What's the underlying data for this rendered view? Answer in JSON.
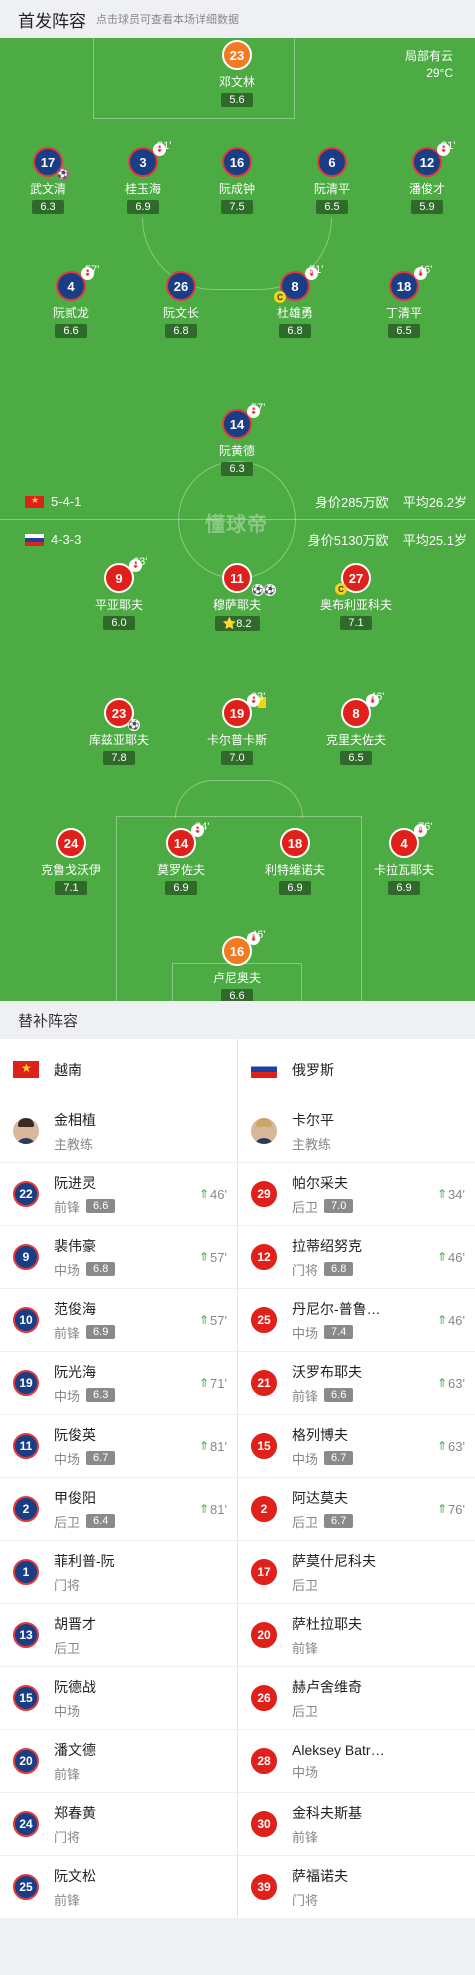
{
  "header": {
    "title": "首发阵容",
    "subtitle": "点击球员可查看本场详细数据"
  },
  "weather": {
    "condition": "局部有云",
    "temperature": "29°C"
  },
  "watermark": "懂球帝",
  "vietnam": {
    "formation": "5-4-1",
    "value": "身价285万欧",
    "avg_age": "平均26.2岁"
  },
  "russia": {
    "formation": "4-3-3",
    "value": "身价5130万欧",
    "avg_age": "平均25.1岁"
  },
  "lineup": {
    "vn_gk": {
      "number": "23",
      "name": "邓文林",
      "rating": "5.6"
    },
    "vn_d1": {
      "number": "17",
      "name": "武文清",
      "rating": "6.3"
    },
    "vn_d2": {
      "number": "3",
      "name": "桂玉海",
      "rating": "6.9",
      "sub_min": "81'"
    },
    "vn_d3": {
      "number": "16",
      "name": "阮成钟",
      "rating": "7.5"
    },
    "vn_d4": {
      "number": "6",
      "name": "阮清平",
      "rating": "6.5"
    },
    "vn_d5": {
      "number": "12",
      "name": "潘俊才",
      "rating": "5.9",
      "sub_min": "81'"
    },
    "vn_m1": {
      "number": "4",
      "name": "阮贰龙",
      "rating": "6.6",
      "sub_min": "57'"
    },
    "vn_m2": {
      "number": "26",
      "name": "阮文长",
      "rating": "6.8"
    },
    "vn_m3": {
      "number": "8",
      "name": "杜雄勇",
      "rating": "6.8",
      "sub_min": "71'"
    },
    "vn_m4": {
      "number": "18",
      "name": "丁清平",
      "rating": "6.5",
      "sub_min": "46'"
    },
    "vn_f1": {
      "number": "14",
      "name": "阮黄德",
      "rating": "6.3",
      "sub_min": "57'"
    },
    "ru_f1": {
      "number": "9",
      "name": "平亚耶夫",
      "rating": "6.0",
      "sub_min": "63'"
    },
    "ru_f2": {
      "number": "11",
      "name": "穆萨耶夫",
      "rating": "8.2"
    },
    "ru_f3": {
      "number": "27",
      "name": "奥布利亚科夫",
      "rating": "7.1"
    },
    "ru_m1": {
      "number": "23",
      "name": "库兹亚耶夫",
      "rating": "7.8"
    },
    "ru_m2": {
      "number": "19",
      "name": "卡尔普卡斯",
      "rating": "7.0",
      "sub_min": "63'"
    },
    "ru_m3": {
      "number": "8",
      "name": "克里夫佐夫",
      "rating": "6.5",
      "sub_min": "46'"
    },
    "ru_d1": {
      "number": "24",
      "name": "克鲁戈沃伊",
      "rating": "7.1"
    },
    "ru_d2": {
      "number": "14",
      "name": "莫罗佐夫",
      "rating": "6.9",
      "sub_min": "34'"
    },
    "ru_d3": {
      "number": "18",
      "name": "利特维诺夫",
      "rating": "6.9"
    },
    "ru_d4": {
      "number": "4",
      "name": "卡拉瓦耶夫",
      "rating": "6.9",
      "sub_min": "76'"
    },
    "ru_gk": {
      "number": "16",
      "name": "卢尼奥夫",
      "rating": "6.6",
      "sub_min": "46'"
    }
  },
  "subs_title": "替补阵容",
  "vn_subs": {
    "team": "越南",
    "coach": {
      "name": "金相植",
      "role": "主教练"
    },
    "players": [
      {
        "number": "22",
        "name": "阮进灵",
        "pos": "前锋",
        "rating": "6.6",
        "min": "46'"
      },
      {
        "number": "9",
        "name": "裴伟豪",
        "pos": "中场",
        "rating": "6.8",
        "min": "57'"
      },
      {
        "number": "10",
        "name": "范俊海",
        "pos": "前锋",
        "rating": "6.9",
        "min": "57'"
      },
      {
        "number": "19",
        "name": "阮光海",
        "pos": "中场",
        "rating": "6.3",
        "min": "71'"
      },
      {
        "number": "11",
        "name": "阮俊英",
        "pos": "中场",
        "rating": "6.7",
        "min": "81'"
      },
      {
        "number": "2",
        "name": "甲俊阳",
        "pos": "后卫",
        "rating": "6.4",
        "min": "81'"
      },
      {
        "number": "1",
        "name": "菲利普-阮",
        "pos": "门将"
      },
      {
        "number": "13",
        "name": "胡晋才",
        "pos": "后卫"
      },
      {
        "number": "15",
        "name": "阮德战",
        "pos": "中场"
      },
      {
        "number": "20",
        "name": "潘文德",
        "pos": "前锋"
      },
      {
        "number": "24",
        "name": "郑春黄",
        "pos": "门将"
      },
      {
        "number": "25",
        "name": "阮文松",
        "pos": "前锋"
      }
    ]
  },
  "ru_subs": {
    "team": "俄罗斯",
    "coach": {
      "name": "卡尔平",
      "role": "主教练"
    },
    "players": [
      {
        "number": "29",
        "name": "帕尔采夫",
        "pos": "后卫",
        "rating": "7.0",
        "min": "34'"
      },
      {
        "number": "12",
        "name": "拉蒂绍努克",
        "pos": "门将",
        "rating": "6.8",
        "min": "46'"
      },
      {
        "number": "25",
        "name": "丹尼尔-普鲁…",
        "pos": "中场",
        "rating": "7.4",
        "min": "46'"
      },
      {
        "number": "21",
        "name": "沃罗布耶夫",
        "pos": "前锋",
        "rating": "6.6",
        "min": "63'"
      },
      {
        "number": "15",
        "name": "格列博夫",
        "pos": "中场",
        "rating": "6.7",
        "min": "63'"
      },
      {
        "number": "2",
        "name": "阿达莫夫",
        "pos": "后卫",
        "rating": "6.7",
        "min": "76'"
      },
      {
        "number": "17",
        "name": "萨莫什尼科夫",
        "pos": "后卫"
      },
      {
        "number": "20",
        "name": "萨杜拉耶夫",
        "pos": "前锋"
      },
      {
        "number": "26",
        "name": "赫卢舍维奇",
        "pos": "后卫"
      },
      {
        "number": "28",
        "name": "Aleksey Batr…",
        "pos": "中场"
      },
      {
        "number": "30",
        "name": "金科夫斯基",
        "pos": "前锋"
      },
      {
        "number": "39",
        "name": "萨福诺夫",
        "pos": "门将"
      }
    ]
  }
}
